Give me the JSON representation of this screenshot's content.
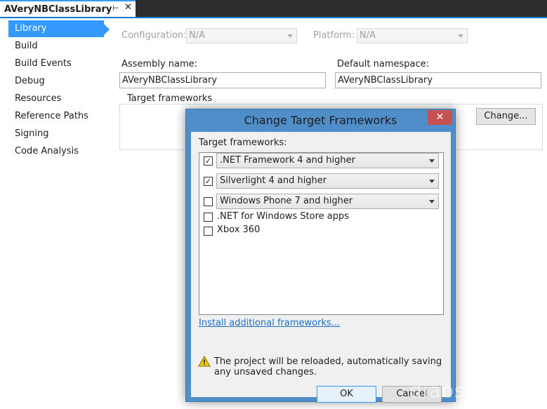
{
  "document_tab": {
    "title": "AVeryNBClassLibrary",
    "pin_icon": "pin-icon",
    "close_icon": "close-icon"
  },
  "nav": {
    "items": [
      {
        "label": "Library",
        "active": true
      },
      {
        "label": "Build",
        "active": false
      },
      {
        "label": "Build Events",
        "active": false
      },
      {
        "label": "Debug",
        "active": false
      },
      {
        "label": "Resources",
        "active": false
      },
      {
        "label": "Reference Paths",
        "active": false
      },
      {
        "label": "Signing",
        "active": false
      },
      {
        "label": "Code Analysis",
        "active": false
      }
    ]
  },
  "config": {
    "configuration_label": "Configuration:",
    "configuration_value": "N/A",
    "platform_label": "Platform:",
    "platform_value": "N/A"
  },
  "assembly": {
    "name_label": "Assembly name:",
    "name_value": "AVeryNBClassLibrary",
    "namespace_label": "Default namespace:",
    "namespace_value": "AVeryNBClassLibrary"
  },
  "target_frameworks": {
    "group_label": "Target frameworks",
    "change_button": "Change..."
  },
  "dialog": {
    "title": "Change Target Frameworks",
    "close_icon": "close-icon",
    "list_label": "Target frameworks:",
    "frameworks": [
      {
        "label": ".NET Framework 4 and higher",
        "checked": true,
        "dropdown": true
      },
      {
        "label": "Silverlight 4 and higher",
        "checked": true,
        "dropdown": true
      },
      {
        "label": "Windows Phone 7 and higher",
        "checked": false,
        "dropdown": true
      },
      {
        "label": ".NET for Windows Store apps",
        "checked": false,
        "dropdown": false
      },
      {
        "label": "Xbox 360",
        "checked": false,
        "dropdown": false
      }
    ],
    "install_link": "Install additional frameworks...",
    "warning_icon": "warning-icon",
    "warning_text": "The project will be reloaded, automatically saving any unsaved changes.",
    "ok_button": "OK",
    "cancel_button": "Cancel"
  },
  "colors": {
    "accent": "#3399ff",
    "dialog_frame": "#4f8ec9",
    "close_button": "#c75050",
    "link": "#1a6fc9"
  },
  "watermark": "diaosbook.com"
}
